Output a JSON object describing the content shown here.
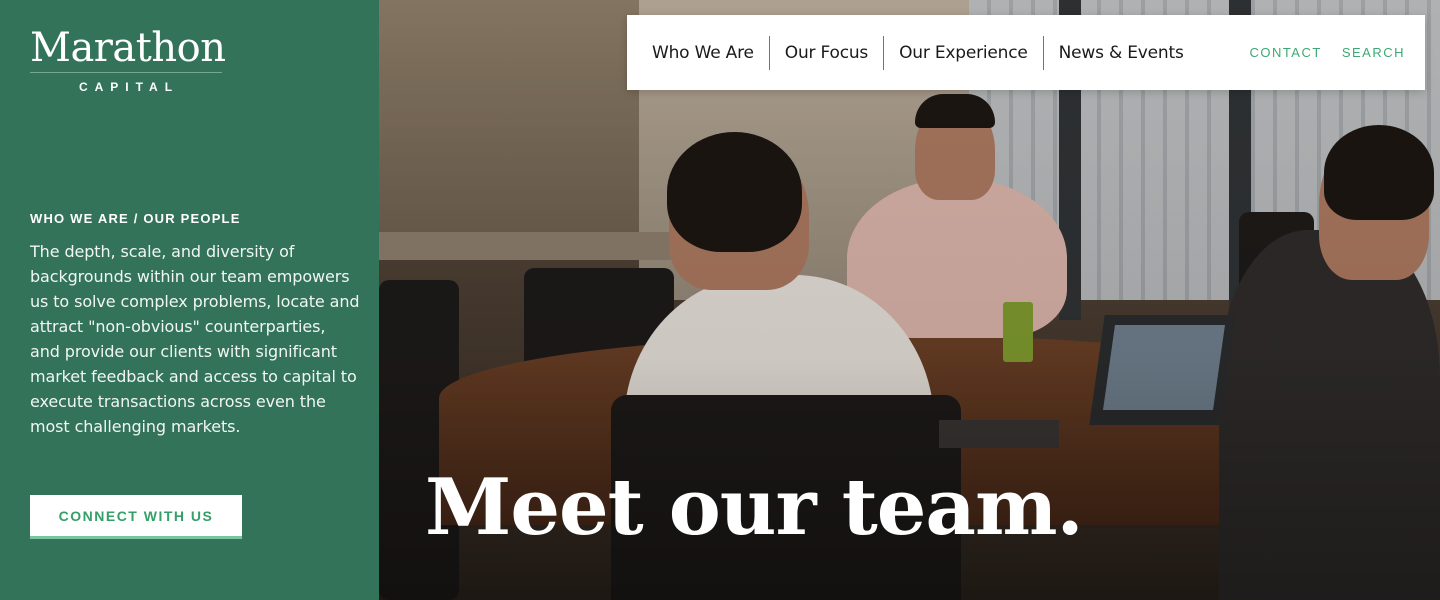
{
  "brand": {
    "name": "Marathon",
    "sub": "CAPITAL"
  },
  "sidebar": {
    "eyebrow": "WHO WE ARE / OUR PEOPLE",
    "intro": "The depth, scale, and diversity of backgrounds within our team empowers us to solve complex problems, locate and attract \"non-obvious\" counterparties, and provide our clients with significant market feedback and access to capital to execute transactions across even the most challenging markets.",
    "cta_label": "CONNECT WITH US"
  },
  "nav": {
    "items": [
      {
        "label": "Who We Are"
      },
      {
        "label": "Our Focus"
      },
      {
        "label": "Our Experience"
      },
      {
        "label": "News & Events"
      }
    ],
    "contact": "CONTACT",
    "search": "SEARCH"
  },
  "hero": {
    "headline": "Meet our team."
  },
  "colors": {
    "brand_green": "#33735a",
    "accent_green": "#3ea874",
    "nav_divider": "#3f8f70"
  }
}
